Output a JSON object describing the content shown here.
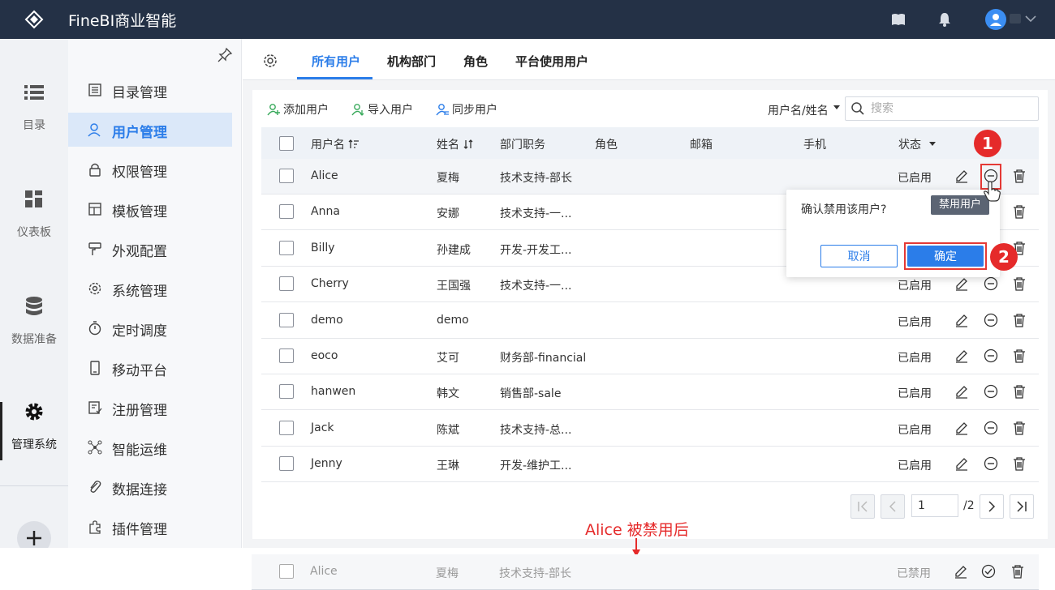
{
  "app": {
    "title": "FineBI商业智能"
  },
  "rail": {
    "items": [
      {
        "label": "目录",
        "icon": "list-icon"
      },
      {
        "label": "仪表板",
        "icon": "dashboard-icon"
      },
      {
        "label": "数据准备",
        "icon": "database-icon"
      },
      {
        "label": "管理系统",
        "icon": "gear-icon",
        "active": true
      }
    ]
  },
  "menu": {
    "items": [
      {
        "label": "目录管理",
        "icon": "catalog-icon"
      },
      {
        "label": "用户管理",
        "icon": "user-icon",
        "active": true
      },
      {
        "label": "权限管理",
        "icon": "lock-icon"
      },
      {
        "label": "模板管理",
        "icon": "template-icon"
      },
      {
        "label": "外观配置",
        "icon": "brush-icon"
      },
      {
        "label": "系统管理",
        "icon": "settings-icon"
      },
      {
        "label": "定时调度",
        "icon": "timer-icon"
      },
      {
        "label": "移动平台",
        "icon": "mobile-icon"
      },
      {
        "label": "注册管理",
        "icon": "register-icon"
      },
      {
        "label": "智能运维",
        "icon": "ops-icon"
      },
      {
        "label": "数据连接",
        "icon": "link-icon"
      },
      {
        "label": "插件管理",
        "icon": "plugin-icon"
      }
    ]
  },
  "tabs": [
    {
      "label": "所有用户",
      "active": true
    },
    {
      "label": "机构部门"
    },
    {
      "label": "角色"
    },
    {
      "label": "平台使用用户"
    }
  ],
  "toolbar": {
    "add": "添加用户",
    "import": "导入用户",
    "sync": "同步用户",
    "filter": "用户名/姓名",
    "search_placeholder": "搜索"
  },
  "table": {
    "headers": {
      "username": "用户名",
      "name": "姓名",
      "dept": "部门职务",
      "role": "角色",
      "email": "邮箱",
      "phone": "手机",
      "status": "状态"
    },
    "rows": [
      {
        "username": "Alice",
        "name": "夏梅",
        "dept": "技术支持-部长",
        "status": "已启用"
      },
      {
        "username": "Anna",
        "name": "安娜",
        "dept": "技术支持-一...",
        "status": ""
      },
      {
        "username": "Billy",
        "name": "孙建成",
        "dept": "开发-开发工...",
        "status": ""
      },
      {
        "username": "Cherry",
        "name": "王国强",
        "dept": "技术支持-一...",
        "status": "已启用"
      },
      {
        "username": "demo",
        "name": "demo",
        "dept": "",
        "status": "已启用"
      },
      {
        "username": "eoco",
        "name": "艾可",
        "dept": "财务部-financial",
        "status": "已启用"
      },
      {
        "username": "hanwen",
        "name": "韩文",
        "dept": "销售部-sale",
        "status": "已启用"
      },
      {
        "username": "Jack",
        "name": "陈斌",
        "dept": "技术支持-总...",
        "status": "已启用"
      },
      {
        "username": "Jenny",
        "name": "王琳",
        "dept": "开发-维护工...",
        "status": "已启用"
      }
    ]
  },
  "popconfirm": {
    "message": "确认禁用该用户?",
    "cancel": "取消",
    "ok": "确定",
    "tooltip": "禁用用户"
  },
  "badges": {
    "one": "1",
    "two": "2"
  },
  "pagination": {
    "page": "1",
    "total": "/2"
  },
  "after": {
    "label": "Alice 被禁用后",
    "row": {
      "username": "Alice",
      "name": "夏梅",
      "dept": "技术支持-部长",
      "status": "已禁用"
    }
  },
  "colors": {
    "primary": "#2b7de9",
    "topbar": "#243146",
    "highlight": "#e53935"
  }
}
